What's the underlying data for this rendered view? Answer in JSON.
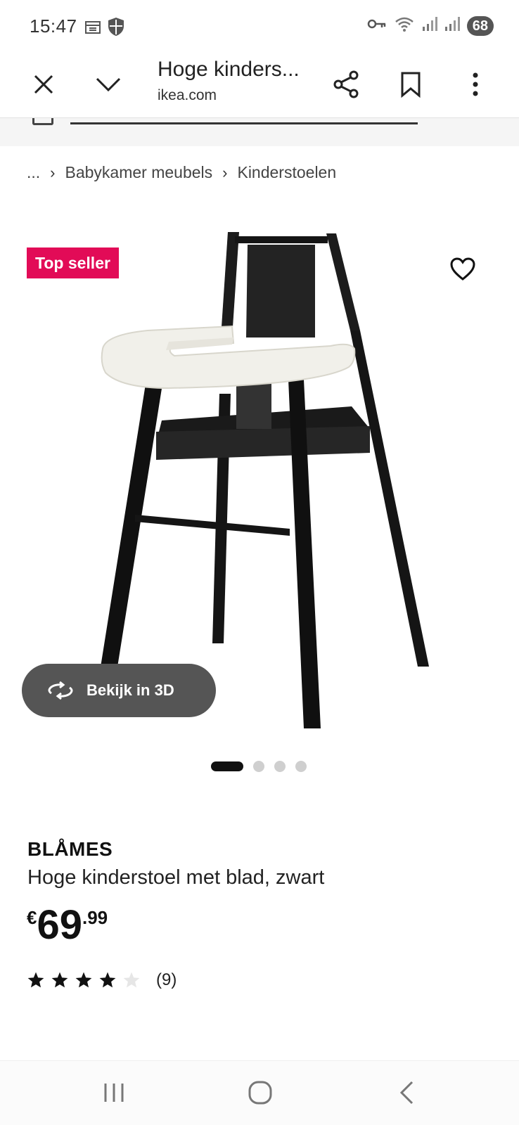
{
  "status_bar": {
    "time": "15:47",
    "battery": "68"
  },
  "browser": {
    "title": "Hoge kinders...",
    "url": "ikea.com"
  },
  "breadcrumb": {
    "ellipsis": "...",
    "items": [
      "Babykamer meubels",
      "Kinderstoelen"
    ]
  },
  "product": {
    "badge": "Top seller",
    "view_3d_label": "Bekijk in 3D",
    "brand": "BLÅMES",
    "description": "Hoge kinderstoel met blad, zwart",
    "price": {
      "currency": "€",
      "integer": "69",
      "decimal": ".99"
    },
    "rating": {
      "stars": 4,
      "max": 5,
      "count": "(9)"
    },
    "gallery": {
      "total": 4,
      "active": 1
    }
  },
  "colors": {
    "badge": "#e20b57",
    "button_3d": "#555555",
    "text": "#111111"
  }
}
